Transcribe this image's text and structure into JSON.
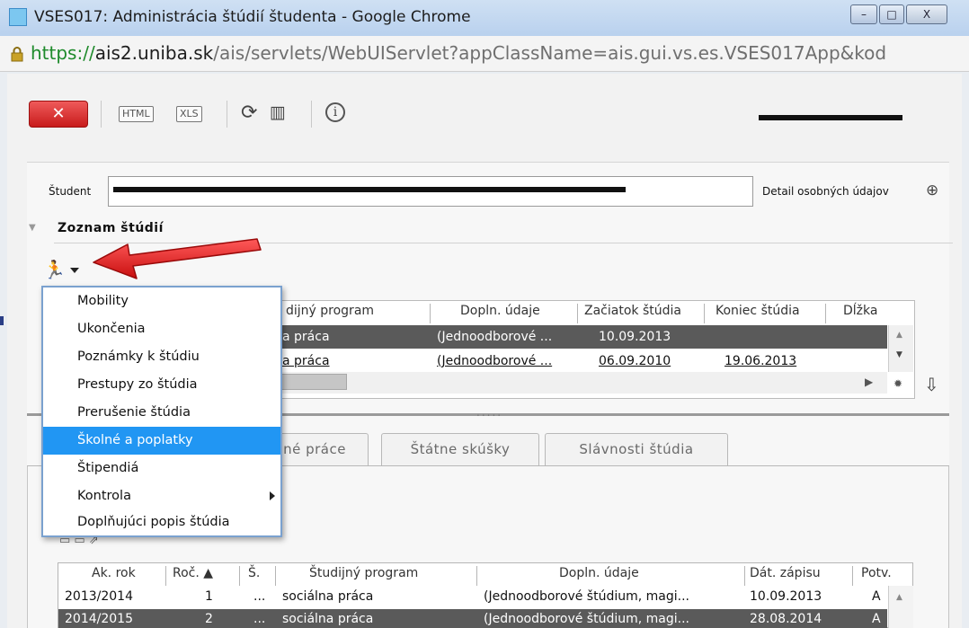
{
  "window": {
    "title": "VSES017: Administrácia štúdií študenta - Google Chrome",
    "min": "–",
    "max": "□",
    "close": "X"
  },
  "address": {
    "scheme": "https://",
    "host": "ais2.uniba.sk",
    "path": "/ais/servlets/WebUIServlet?appClassName=ais.gui.vs.es.VSES017App&kod"
  },
  "toolbar": {
    "close": "✕",
    "html": "HTML",
    "xls": "XLS",
    "refresh": "⟳",
    "grid": "▥",
    "info": "i"
  },
  "header": {
    "student_label": "Študent",
    "detail_label": "Detail osobných údajov",
    "zoom": "⊕"
  },
  "section": {
    "collapse": "▼",
    "title": "Zoznam štúdií",
    "run": "🏃"
  },
  "studies_table": {
    "columns": [
      "dijný program",
      "Dopln. údaje",
      "Začiatok štúdia",
      "Koniec štúdia",
      "Dĺžka"
    ],
    "rows": [
      [
        "a práca",
        "(Jednoodborové ...",
        "10.09.2013",
        ""
      ],
      [
        "a práca",
        "(Jednoodborové ...",
        "06.09.2010",
        "19.06.2013"
      ]
    ],
    "scroll_up": "▲",
    "scroll_down": "▼",
    "right": "▶",
    "gear": "✹",
    "download": "⇩",
    "splitter": "....."
  },
  "menu": {
    "items": [
      "Mobility",
      "Ukončenia",
      "Poznámky k štúdiu",
      "Prestupy zo štúdia",
      "Prerušenie štúdia",
      "Školné a poplatky",
      "Štipendiá",
      "Kontrola",
      "Doplňujúci popis štúdia"
    ],
    "highlighted": "Školné a poplatky"
  },
  "tabs": [
    "né práce",
    "Štátne skúšky",
    "Slávnosti štúdia"
  ],
  "enrollment_table": {
    "columns": [
      "Ak. rok",
      "Roč. ▲",
      "Š.",
      "Študijný program",
      "Dopln. údaje",
      "Dát. zápisu",
      "Potv."
    ],
    "rows": [
      [
        "2013/2014",
        "1",
        "...",
        "sociálna práca",
        "(Jednoodborové štúdium, magi...",
        "10.09.2013",
        "A"
      ],
      [
        "2014/2015",
        "2",
        "...",
        "sociálna práca",
        "(Jednoodborové štúdium, magi...",
        "28.08.2014",
        "A"
      ]
    ],
    "scroll_up": "▲"
  },
  "colors": {
    "accent": "#2196f3",
    "close_button": "#d22a2a",
    "selected_row": "#5a5a5a",
    "arrow": "#e31b1b"
  }
}
